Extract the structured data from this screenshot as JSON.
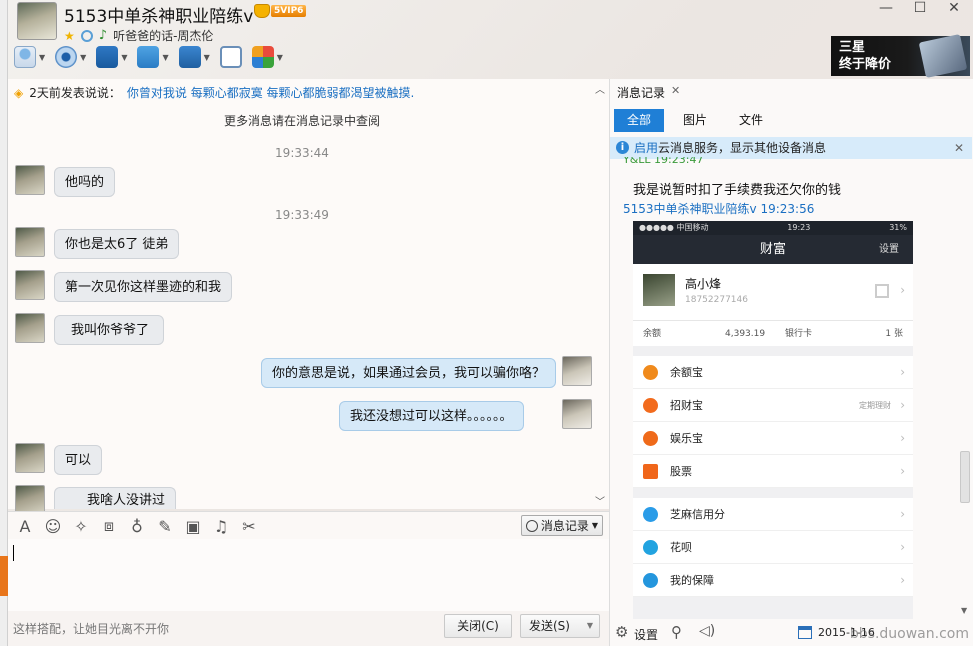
{
  "header": {
    "title": "5153中单杀神职业陪练v",
    "vip_label": "5VIP6",
    "song": "听爸爸的话-周杰伦"
  },
  "ad": {
    "line1": "三星",
    "line2": "终于降价"
  },
  "chat": {
    "notice_label": "2天前发表说说：",
    "notice_text": "你曾对我说 每颗心都寂寞 每颗心都脆弱都渴望被触摸.",
    "more_history": "更多消息请在消息记录中查阅",
    "timestamps": [
      "19:33:44",
      "19:33:49"
    ],
    "messages": [
      {
        "side": "left",
        "text": "他吗的"
      },
      {
        "side": "left",
        "text": "你也是太6了 徒弟"
      },
      {
        "side": "left",
        "text": "第一次见你这样墨迹的和我"
      },
      {
        "side": "left",
        "text": "我叫你爷爷了"
      },
      {
        "side": "right",
        "text": "你的意思是说，如果通过会员，我可以骗你咯？"
      },
      {
        "side": "right",
        "text": "我还没想过可以这样。。。。。。"
      },
      {
        "side": "left",
        "text": "可以"
      },
      {
        "side": "left",
        "text": "我啥人没讲过"
      }
    ]
  },
  "input": {
    "history_button": "消息记录",
    "tip": "这样搭配，让她目光离不开你",
    "close_label": "关闭(C)",
    "send_label": "发送(S)"
  },
  "history_panel": {
    "tab_title": "消息记录",
    "filters": [
      "全部",
      "图片",
      "文件"
    ],
    "cloud_enable": "启用",
    "cloud_text": "云消息服务，显示其他设备消息",
    "partial_sender": "Y&LL 19:23:47",
    "message": "我是说暂时扣了手续费我还欠你的钱",
    "sender_line": "5153中单杀神职业陪练v 19:23:56",
    "settings_label": "设置",
    "date": "2015-1-16"
  },
  "phone_screenshot": {
    "carrier": "●●●●● 中国移动",
    "time": "19:23",
    "battery": "31%",
    "nav_title": "财富",
    "nav_right": "设置",
    "user_name": "高小烽",
    "user_phone": "18752277146",
    "balance_label": "余额",
    "balance_value": "4,393.19",
    "card_label": "银行卡",
    "card_value": "1 张",
    "items": [
      {
        "label": "余额宝",
        "extra": "",
        "color": "#f08a1c"
      },
      {
        "label": "招财宝",
        "extra": "定期理财",
        "color": "#f26b1d"
      },
      {
        "label": "娱乐宝",
        "extra": "",
        "color": "#ef6a1a"
      },
      {
        "label": "股票",
        "extra": "",
        "color": "#f0661a"
      }
    ],
    "items2": [
      {
        "label": "芝麻信用分",
        "color": "#2a9ce8"
      },
      {
        "label": "花呗",
        "color": "#22a3e0"
      },
      {
        "label": "我的保障",
        "color": "#2496dd"
      }
    ]
  },
  "watermark": "bbs.duowan.com"
}
